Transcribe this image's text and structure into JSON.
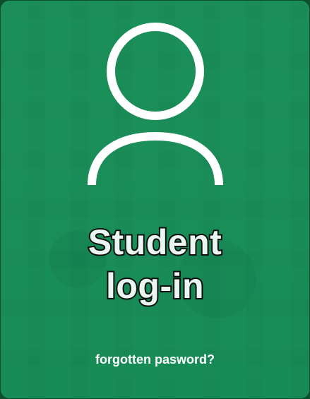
{
  "card": {
    "title_line1": "Student",
    "title_line2": "log-in",
    "forgot_label": "forgotten pasword?"
  },
  "icons": {
    "user": "user-icon"
  },
  "colors": {
    "background_green": "#178a55",
    "title_fill": "#eaf6f1",
    "title_stroke": "#0b0f0d",
    "icon_stroke": "#ffffff"
  }
}
